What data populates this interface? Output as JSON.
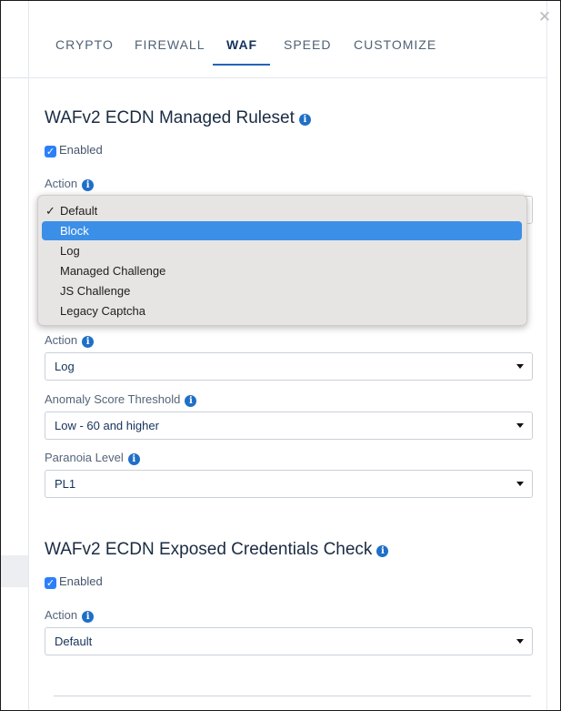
{
  "tabs": [
    {
      "label": "CRYPTO"
    },
    {
      "label": "FIREWALL"
    },
    {
      "label": "WAF"
    },
    {
      "label": "SPEED"
    },
    {
      "label": "CUSTOMIZE"
    }
  ],
  "active_tab": "WAF",
  "close_icon": "✕",
  "managed_ruleset": {
    "title": "WAFv2 ECDN Managed Ruleset",
    "enabled_label": "Enabled",
    "enabled": true,
    "action_label": "Action",
    "action_dropdown": {
      "options": [
        "Default",
        "Block",
        "Log",
        "Managed Challenge",
        "JS Challenge",
        "Legacy Captcha"
      ],
      "checked": "Default",
      "highlighted": "Block"
    }
  },
  "owasp": {
    "action_label": "Action",
    "action_value": "Log",
    "threshold_label": "Anomaly Score Threshold",
    "threshold_value": "Low - 60 and higher",
    "paranoia_label": "Paranoia Level",
    "paranoia_value": "PL1"
  },
  "exposed_credentials": {
    "title": "WAFv2 ECDN Exposed Credentials Check",
    "enabled_label": "Enabled",
    "enabled": true,
    "action_label": "Action",
    "action_value": "Default"
  },
  "icons": {
    "info": "info-icon",
    "checkbox": "checkbox-checked-icon",
    "caret": "caret-down-icon",
    "close": "close-icon"
  },
  "colors": {
    "accent": "#2463b8",
    "info_icon": "#1f6fc7",
    "checkbox": "#2d7ff9",
    "dropdown_highlight": "#3b8fe7"
  }
}
